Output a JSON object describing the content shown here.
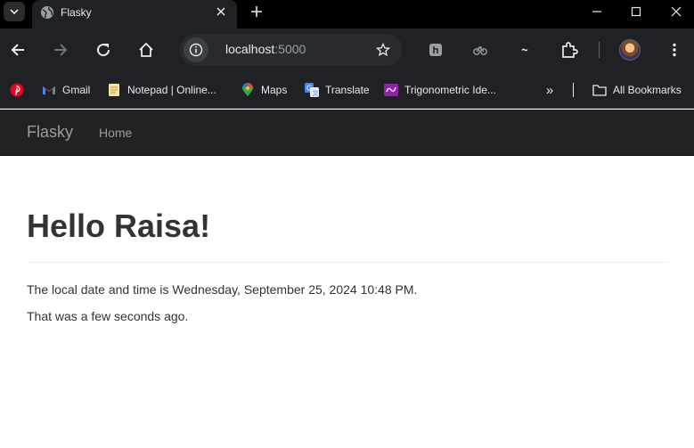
{
  "browser": {
    "tab": {
      "title": "Flasky"
    },
    "address": {
      "host": "localhost",
      "port": ":5000"
    },
    "bookmarks": [
      {
        "label": ""
      },
      {
        "label": "Gmail"
      },
      {
        "label": "Notepad | Online..."
      },
      {
        "label": "Maps"
      },
      {
        "label": "Translate"
      },
      {
        "label": "Trigonometric Ide..."
      }
    ],
    "bookmarks_more": "»",
    "all_bookmarks": "All Bookmarks",
    "colors": {
      "titlebar": "#000000",
      "toolbar": "#202124",
      "omnibox": "#282a2d"
    }
  },
  "navbar": {
    "brand": "Flasky",
    "links": [
      {
        "label": "Home"
      }
    ],
    "background": "#222222"
  },
  "page": {
    "greeting": "Hello Raisa!",
    "datetime_line": "The local date and time is Wednesday, September 25, 2024 10:48 PM.",
    "relative_line": "That was a few seconds ago."
  }
}
